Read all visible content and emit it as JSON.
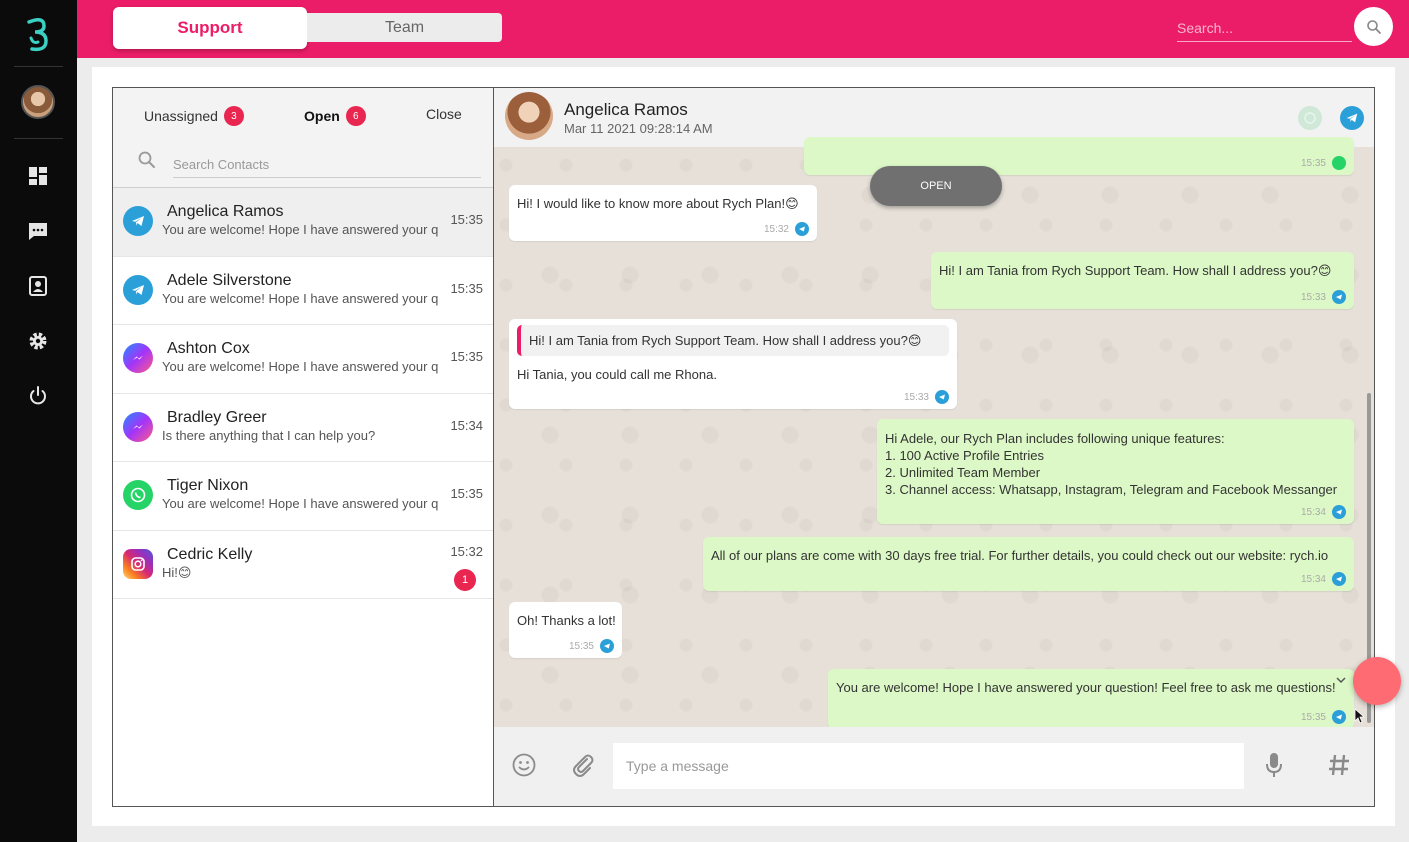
{
  "header": {
    "tab_support": "Support",
    "tab_team": "Team",
    "search_placeholder": "Search..."
  },
  "contact_list": {
    "tabs": [
      {
        "label": "Unassigned",
        "count": "3"
      },
      {
        "label": "Open",
        "count": "6"
      },
      {
        "label": "Close"
      }
    ],
    "search_placeholder": "Search Contacts",
    "contacts": [
      {
        "name": "Angelica Ramos",
        "message": "You are welcome! Hope I have answered your question!",
        "time": "15:35",
        "channel": "telegram-icon"
      },
      {
        "name": "Adele Silverstone",
        "message": "You are welcome! Hope I have answered your question!",
        "time": "15:35",
        "channel": "telegram-icon"
      },
      {
        "name": "Ashton Cox",
        "message": "You are welcome! Hope I have answered your question!",
        "time": "15:35",
        "channel": "messenger-icon"
      },
      {
        "name": "Bradley Greer",
        "message": "Is there anything that I can help you?",
        "time": "15:34",
        "channel": "messenger-icon"
      },
      {
        "name": "Tiger Nixon",
        "message": "You are welcome! Hope I have answered your question!",
        "time": "15:35",
        "channel": "whatsapp-icon"
      },
      {
        "name": "Cedric Kelly",
        "message": "Hi!😊",
        "time": "15:32",
        "channel": "instagram-icon",
        "unread": "1"
      }
    ]
  },
  "chat": {
    "name": "Angelica Ramos",
    "date": "Mar 11 2021 09:28:14 AM",
    "status_pill": "OPEN",
    "messages": [
      {
        "dir": "out",
        "text": "",
        "time": "15:35"
      },
      {
        "dir": "in",
        "text": "Hi! I would like to know more about Rych Plan!😊",
        "time": "15:32"
      },
      {
        "dir": "out",
        "text": "Hi! I am Tania from Rych Support Team. How shall I address you?😊",
        "time": "15:33"
      },
      {
        "dir": "in",
        "quote": "Hi! I am Tania from Rych Support Team. How shall I address you?😊",
        "text": "Hi Tania, you could call me Rhona.",
        "time": "15:33"
      },
      {
        "dir": "out",
        "lines": [
          "Hi Adele, our Rych Plan includes following unique features:",
          "1. 100 Active Profile Entries",
          "2. Unlimited Team Member",
          "3. Channel access: Whatsapp, Instagram, Telegram and Facebook Messanger"
        ],
        "time": "15:34"
      },
      {
        "dir": "out",
        "text": "All of our plans are come with 30 days free trial. For further details, you could check out our website: rych.io",
        "time": "15:34"
      },
      {
        "dir": "in",
        "text": "Oh! Thanks a lot!",
        "time": "15:35"
      },
      {
        "dir": "out",
        "text": "You are welcome! Hope I have answered your question! Feel free to ask me questions!",
        "time": "15:35"
      }
    ],
    "composer_placeholder": "Type a message"
  },
  "colors": {
    "brand": "#ec1d68",
    "badge": "#e8264f",
    "outgoing_bubble": "#dcf8c6",
    "telegram": "#2a9fd8",
    "whatsapp": "#25d366",
    "fab": "#ff6b73"
  }
}
